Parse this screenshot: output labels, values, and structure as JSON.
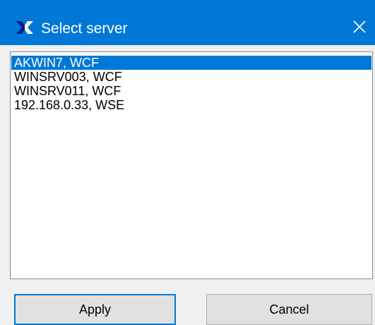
{
  "window": {
    "title": "Select server",
    "app_icon": "app-logo-icon",
    "close_icon": "close-icon",
    "accent_color": "#0078d7"
  },
  "server_list": {
    "items": [
      {
        "label": "AKWIN7, WCF",
        "selected": true
      },
      {
        "label": "WINSRV003, WCF",
        "selected": false
      },
      {
        "label": "WINSRV011, WCF",
        "selected": false
      },
      {
        "label": "192.168.0.33, WSE",
        "selected": false
      }
    ]
  },
  "buttons": {
    "apply_label": "Apply",
    "cancel_label": "Cancel"
  }
}
